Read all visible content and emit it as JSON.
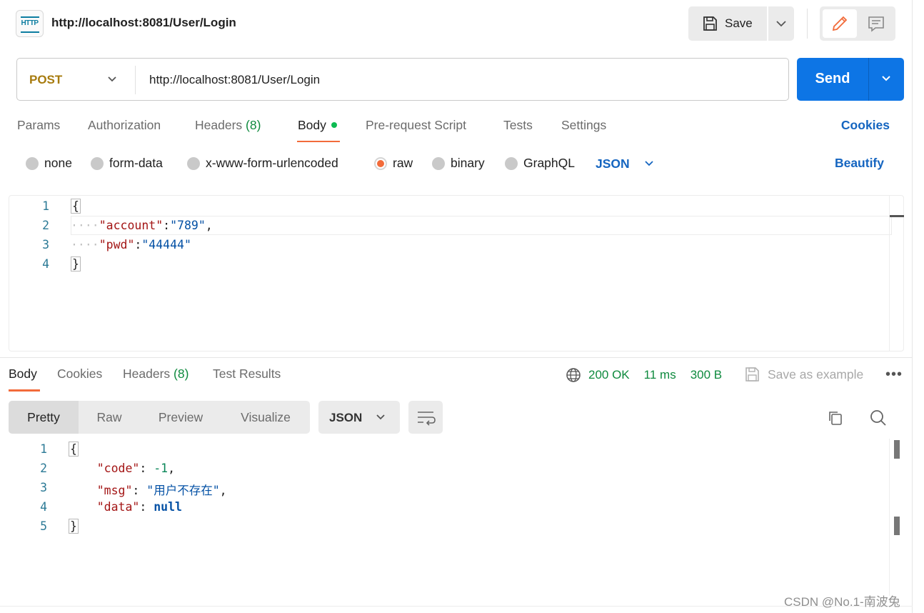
{
  "header": {
    "request_title": "http://localhost:8081/User/Login",
    "badge_text": "HTTP",
    "save_label": "Save"
  },
  "request": {
    "method": "POST",
    "url": "http://localhost:8081/User/Login",
    "send_label": "Send"
  },
  "request_tabs": {
    "params": "Params",
    "authorization": "Authorization",
    "headers": "Headers",
    "headers_count": "(8)",
    "body": "Body",
    "prerequest": "Pre-request Script",
    "tests": "Tests",
    "settings": "Settings",
    "cookies": "Cookies"
  },
  "body_types": {
    "none": "none",
    "form_data": "form-data",
    "urlencoded": "x-www-form-urlencoded",
    "raw": "raw",
    "binary": "binary",
    "graphql": "GraphQL",
    "language": "JSON",
    "beautify": "Beautify"
  },
  "request_body": {
    "line_numbers": [
      "1",
      "2",
      "3",
      "4"
    ],
    "open_brace": "{",
    "close_brace": "}",
    "key1": "\"account\"",
    "val1": "\"789\"",
    "key2": "\"pwd\"",
    "val2": "\"44444\""
  },
  "response_tabs": {
    "body": "Body",
    "cookies": "Cookies",
    "headers": "Headers",
    "headers_count": "(8)",
    "test_results": "Test Results"
  },
  "response_meta": {
    "status": "200 OK",
    "time": "11 ms",
    "size": "300 B",
    "save_example": "Save as example",
    "more": "•••"
  },
  "response_view": {
    "pretty": "Pretty",
    "raw": "Raw",
    "preview": "Preview",
    "visualize": "Visualize",
    "format": "JSON"
  },
  "response_body": {
    "line_numbers": [
      "1",
      "2",
      "3",
      "4",
      "5"
    ],
    "open_brace": "{",
    "close_brace": "}",
    "key_code": "\"code\"",
    "val_code": "-1",
    "key_msg": "\"msg\"",
    "val_msg": "\"用户不存在\"",
    "key_data": "\"data\"",
    "val_data": "null"
  },
  "watermark": "CSDN @No.1-南波兔",
  "colors": {
    "accent_orange": "#f26b3a",
    "send_blue": "#0d75e5",
    "link_blue": "#1565c0",
    "status_green": "#0e8a3e",
    "method_gold": "#a77b0e"
  }
}
